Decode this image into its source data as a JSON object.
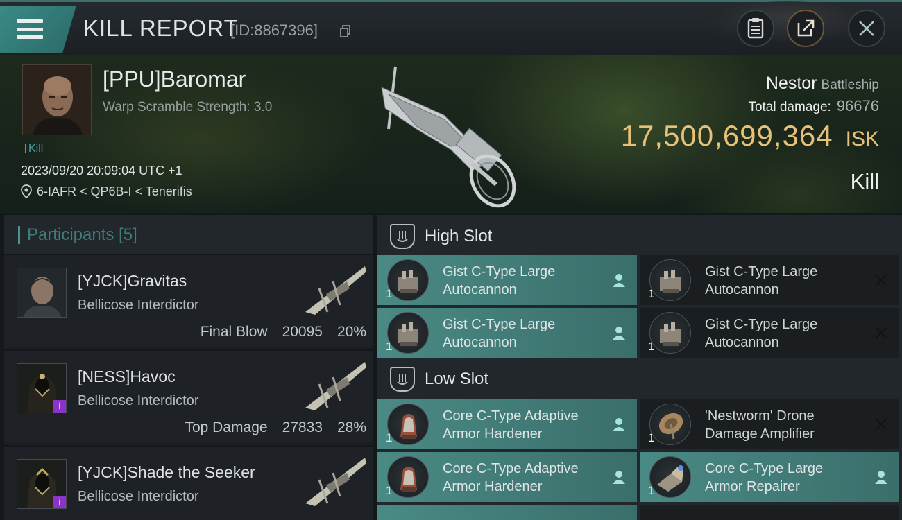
{
  "header": {
    "title": "KILL REPORT",
    "report_id": "[ID:8867396]"
  },
  "victim": {
    "name": "[PPU]Baromar",
    "warp_scramble": "Warp Scramble Strength: 3.0",
    "kill_tag": "Kill",
    "datetime": "2023/09/20 20:09:04 UTC +1",
    "location": "6-IAFR < QP6B-I < Tenerifis",
    "ship_name": "Nestor",
    "ship_class": "Battleship",
    "total_damage_label": "Total damage:",
    "total_damage": "96676",
    "isk_value": "17,500,699,364",
    "isk_unit": "ISK",
    "result": "Kill"
  },
  "participants": {
    "title": "Participants [5]",
    "items": [
      {
        "name": "[YJCK]Gravitas",
        "ship": "Bellicose Interdictor",
        "role": "Final Blow",
        "damage": "20095",
        "percent": "20%",
        "badge": ""
      },
      {
        "name": "[NESS]Havoc",
        "ship": "Bellicose Interdictor",
        "role": "Top Damage",
        "damage": "27833",
        "percent": "28%",
        "badge": "i"
      },
      {
        "name": "[YJCK]Shade the Seeker",
        "ship": "Bellicose Interdictor",
        "role": "",
        "damage": "",
        "percent": "",
        "badge": "i"
      }
    ]
  },
  "fitting": {
    "high_slot_label": "High Slot",
    "low_slot_label": "Low Slot",
    "high_slot": [
      {
        "name": "Gist C-Type Large\nAutocannon",
        "qty": "1",
        "status": "dropped",
        "icon": "autocannon-icon"
      },
      {
        "name": "Gist C-Type Large\nAutocannon",
        "qty": "1",
        "status": "destroyed",
        "icon": "autocannon-icon"
      },
      {
        "name": "Gist C-Type Large\nAutocannon",
        "qty": "1",
        "status": "dropped",
        "icon": "autocannon-icon"
      },
      {
        "name": "Gist C-Type Large\nAutocannon",
        "qty": "1",
        "status": "destroyed",
        "icon": "autocannon-icon"
      }
    ],
    "low_slot": [
      {
        "name": "Core C-Type Adaptive\n Armor Hardener",
        "qty": "1",
        "status": "dropped",
        "icon": "armor-hardener-icon"
      },
      {
        "name": "'Nestworm' Drone\nDamage Amplifier",
        "qty": "1",
        "status": "destroyed",
        "icon": "drone-amplifier-icon"
      },
      {
        "name": "Core C-Type Adaptive\n Armor Hardener",
        "qty": "1",
        "status": "dropped",
        "icon": "armor-hardener-icon"
      },
      {
        "name": "Core C-Type Large\nArmor Repairer",
        "qty": "1",
        "status": "dropped",
        "icon": "armor-repairer-icon"
      }
    ]
  },
  "colors": {
    "accent_teal": "#3a8a86",
    "isk_gold": "#e8c078",
    "dropped_bg": "#4a8a85",
    "badge_purple": "#8b33c8"
  },
  "icons": {
    "menu": "hamburger-menu-icon",
    "copy": "copy-icon",
    "clipboard": "clipboard-icon",
    "share": "share-icon",
    "close": "close-icon",
    "location": "location-pin-icon",
    "slot": "slot-shield-icon",
    "dropped": "person-icon",
    "destroyed": "x-icon"
  }
}
